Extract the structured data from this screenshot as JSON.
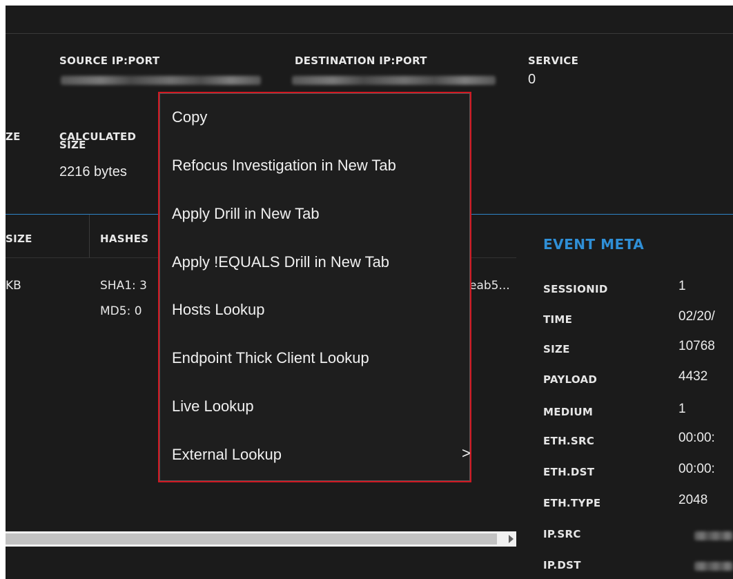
{
  "header": {
    "source_label": "SOURCE IP:PORT",
    "dest_label": "DESTINATION IP:PORT",
    "service_label": "SERVICE",
    "service_value": "0",
    "size_label_partial": "ZE",
    "calc_label_line1": "CALCULATED",
    "calc_label_line2": "SIZE",
    "calc_value": "2216 bytes"
  },
  "table": {
    "col_size": "SIZE",
    "col_hashes": "HASHES",
    "row_size": "KB",
    "sha1": "SHA1: 3",
    "md5": "MD5: 0",
    "hash_tail": "eab5..."
  },
  "event_meta": {
    "title": "EVENT META",
    "rows": [
      {
        "key": "SESSIONID",
        "value": "1"
      },
      {
        "key": "TIME",
        "value": "02/20/"
      },
      {
        "key": "SIZE",
        "value": "10768"
      },
      {
        "key": "PAYLOAD",
        "value": "4432"
      },
      {
        "key": "MEDIUM",
        "value": "1"
      },
      {
        "key": "ETH.SRC",
        "value": "00:00:"
      },
      {
        "key": "ETH.DST",
        "value": "00:00:"
      },
      {
        "key": "ETH.TYPE",
        "value": "2048"
      },
      {
        "key": "IP.SRC",
        "value": ""
      },
      {
        "key": "IP.DST",
        "value": ""
      }
    ]
  },
  "context_menu": {
    "items": [
      "Copy",
      "Refocus Investigation in New Tab",
      "Apply Drill in New Tab",
      "Apply !EQUALS Drill in New Tab",
      "Hosts Lookup",
      "Endpoint Thick Client Lookup",
      "Live Lookup",
      "External Lookup"
    ],
    "submenu_chevron": ">"
  },
  "colors": {
    "background": "#1b1b1b",
    "accent_blue": "#2f8fd6",
    "menu_border": "#d01822"
  }
}
